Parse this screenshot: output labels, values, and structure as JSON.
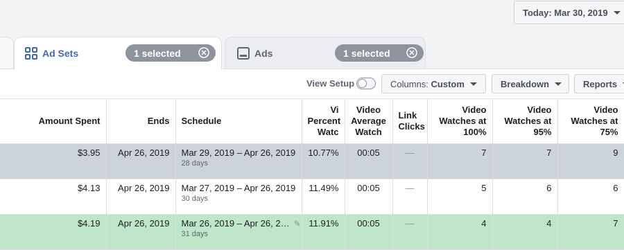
{
  "header": {
    "date_label": "Today: Mar 30, 2019"
  },
  "tabs": [
    {
      "label": "Ad Sets",
      "pill": "1 selected",
      "icon": "ad-sets-grid-icon"
    },
    {
      "label": "Ads",
      "pill": "1 selected",
      "icon": "ads-square-icon"
    }
  ],
  "toolbar": {
    "view_setup": "View Setup",
    "columns": "Columns: ",
    "columns_value": "Custom",
    "breakdown": "Breakdown",
    "reports": "Reports"
  },
  "table": {
    "headers": {
      "amount": "Amount Spent",
      "ends": "Ends",
      "schedule": "Schedule",
      "pct_l1": "Vi",
      "pct_l2": "Percent",
      "pct_l3": "Watc",
      "avg_l1": "Video",
      "avg_l2": "Average",
      "avg_l3": "Watch",
      "link_l1": "Link",
      "link_l2": "Clicks",
      "w100_l1": "Video",
      "w100_l2": "Watches at",
      "w100_l3": "100%",
      "w95_l1": "Video",
      "w95_l2": "Watches at",
      "w95_l3": "95%",
      "w75_l1": "Video",
      "w75_l2": "Watches at",
      "w75_l3": "75%"
    },
    "rows": [
      {
        "amount": "$3.95",
        "ends": "Apr 26, 2019",
        "schedule": "Mar 29, 2019 – Apr 26, 2019",
        "days": "28 days",
        "pct": "10.77%",
        "avg": "00:05",
        "link": "—",
        "w100": "7",
        "w95": "7",
        "w75": "9"
      },
      {
        "amount": "$4.13",
        "ends": "Apr 26, 2019",
        "schedule": "Mar 27, 2019 – Apr 26, 2019",
        "days": "30 days",
        "pct": "11.49%",
        "avg": "00:05",
        "link": "—",
        "w100": "5",
        "w95": "6",
        "w75": "6"
      },
      {
        "amount": "$4.19",
        "ends": "Apr 26, 2019",
        "schedule": "Mar 26, 2019 – Apr 26, 2…",
        "days": "31 days",
        "pct": "11.91%",
        "avg": "00:05",
        "link": "—",
        "w100": "4",
        "w95": "4",
        "w75": "7"
      }
    ]
  },
  "colors": {
    "accent": "#4267b2",
    "row_selected": "#cdd3dd",
    "row_highlight": "#bfe6c8",
    "pill": "#8d949e"
  }
}
